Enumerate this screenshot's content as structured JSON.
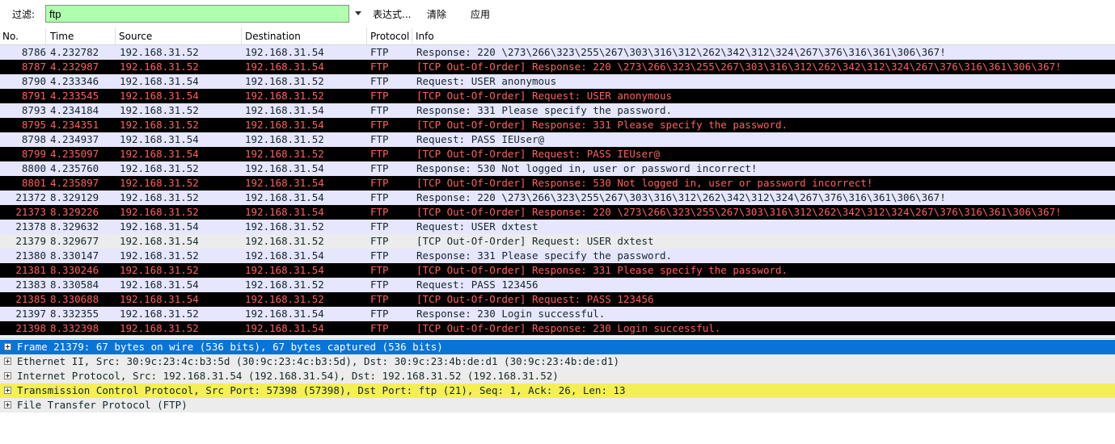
{
  "filter_bar": {
    "label": "过滤:",
    "value": "ftp",
    "expression_button": "表达式...",
    "clear_button": "清除",
    "apply_button": "应用"
  },
  "columns": {
    "no": "No.",
    "time": "Time",
    "source": "Source",
    "destination": "Destination",
    "protocol": "Protocol",
    "info": "Info"
  },
  "packets": [
    {
      "no": "8786",
      "time": "4.232782",
      "src": "192.168.31.52",
      "dst": "192.168.31.54",
      "proto": "FTP",
      "info": "Response: 220 \\273\\266\\323\\255\\267\\303\\316\\312\\262\\342\\312\\324\\267\\376\\316\\361\\306\\367!",
      "style": "ftp"
    },
    {
      "no": "8787",
      "time": "4.232987",
      "src": "192.168.31.52",
      "dst": "192.168.31.54",
      "proto": "FTP",
      "info": "[TCP Out-Of-Order] Response: 220 \\273\\266\\323\\255\\267\\303\\316\\312\\262\\342\\312\\324\\267\\376\\316\\361\\306\\367!",
      "style": "bad"
    },
    {
      "no": "8790",
      "time": "4.233346",
      "src": "192.168.31.54",
      "dst": "192.168.31.52",
      "proto": "FTP",
      "info": "Request: USER anonymous",
      "style": "ftp"
    },
    {
      "no": "8791",
      "time": "4.233545",
      "src": "192.168.31.54",
      "dst": "192.168.31.52",
      "proto": "FTP",
      "info": "[TCP Out-Of-Order] Request: USER anonymous",
      "style": "bad"
    },
    {
      "no": "8793",
      "time": "4.234184",
      "src": "192.168.31.52",
      "dst": "192.168.31.54",
      "proto": "FTP",
      "info": "Response: 331 Please specify the password.",
      "style": "ftp"
    },
    {
      "no": "8795",
      "time": "4.234351",
      "src": "192.168.31.52",
      "dst": "192.168.31.54",
      "proto": "FTP",
      "info": "[TCP Out-Of-Order] Response: 331 Please specify the password.",
      "style": "bad"
    },
    {
      "no": "8798",
      "time": "4.234937",
      "src": "192.168.31.54",
      "dst": "192.168.31.52",
      "proto": "FTP",
      "info": "Request: PASS IEUser@",
      "style": "ftp"
    },
    {
      "no": "8799",
      "time": "4.235097",
      "src": "192.168.31.54",
      "dst": "192.168.31.52",
      "proto": "FTP",
      "info": "[TCP Out-Of-Order] Request: PASS IEUser@",
      "style": "bad"
    },
    {
      "no": "8800",
      "time": "4.235760",
      "src": "192.168.31.52",
      "dst": "192.168.31.54",
      "proto": "FTP",
      "info": "Response: 530 Not logged in, user or password incorrect!",
      "style": "ftp"
    },
    {
      "no": "8801",
      "time": "4.235897",
      "src": "192.168.31.52",
      "dst": "192.168.31.54",
      "proto": "FTP",
      "info": "[TCP Out-Of-Order] Response: 530 Not logged in, user or password incorrect!",
      "style": "bad"
    },
    {
      "no": "21372",
      "time": "8.329129",
      "src": "192.168.31.52",
      "dst": "192.168.31.54",
      "proto": "FTP",
      "info": "Response: 220 \\273\\266\\323\\255\\267\\303\\316\\312\\262\\342\\312\\324\\267\\376\\316\\361\\306\\367!",
      "style": "ftp"
    },
    {
      "no": "21373",
      "time": "8.329226",
      "src": "192.168.31.52",
      "dst": "192.168.31.54",
      "proto": "FTP",
      "info": "[TCP Out-Of-Order] Response: 220 \\273\\266\\323\\255\\267\\303\\316\\312\\262\\342\\312\\324\\267\\376\\316\\361\\306\\367!",
      "style": "bad"
    },
    {
      "no": "21378",
      "time": "8.329632",
      "src": "192.168.31.54",
      "dst": "192.168.31.52",
      "proto": "FTP",
      "info": "Request: USER dxtest",
      "style": "ftp"
    },
    {
      "no": "21379",
      "time": "8.329677",
      "src": "192.168.31.54",
      "dst": "192.168.31.52",
      "proto": "FTP",
      "info": "[TCP Out-Of-Order] Request: USER dxtest",
      "style": "sel"
    },
    {
      "no": "21380",
      "time": "8.330147",
      "src": "192.168.31.52",
      "dst": "192.168.31.54",
      "proto": "FTP",
      "info": "Response: 331 Please specify the password.",
      "style": "ftp"
    },
    {
      "no": "21381",
      "time": "8.330246",
      "src": "192.168.31.52",
      "dst": "192.168.31.54",
      "proto": "FTP",
      "info": "[TCP Out-Of-Order] Response: 331 Please specify the password.",
      "style": "bad"
    },
    {
      "no": "21383",
      "time": "8.330584",
      "src": "192.168.31.54",
      "dst": "192.168.31.52",
      "proto": "FTP",
      "info": "Request: PASS 123456",
      "style": "ftp"
    },
    {
      "no": "21385",
      "time": "8.330688",
      "src": "192.168.31.54",
      "dst": "192.168.31.52",
      "proto": "FTP",
      "info": "[TCP Out-Of-Order] Request: PASS 123456",
      "style": "bad"
    },
    {
      "no": "21397",
      "time": "8.332355",
      "src": "192.168.31.52",
      "dst": "192.168.31.54",
      "proto": "FTP",
      "info": "Response: 230 Login successful.",
      "style": "ftp"
    },
    {
      "no": "21398",
      "time": "8.332398",
      "src": "192.168.31.52",
      "dst": "192.168.31.54",
      "proto": "FTP",
      "info": "[TCP Out-Of-Order] Response: 230 Login successful.",
      "style": "bad"
    }
  ],
  "details": [
    {
      "text": "Frame 21379: 67 bytes on wire (536 bits), 67 bytes captured (536 bits)",
      "style": "selected"
    },
    {
      "text": "Ethernet II, Src: 30:9c:23:4c:b3:5d (30:9c:23:4c:b3:5d), Dst: 30:9c:23:4b:de:d1 (30:9c:23:4b:de:d1)",
      "style": "gray"
    },
    {
      "text": "Internet Protocol, Src: 192.168.31.54 (192.168.31.54), Dst: 192.168.31.52 (192.168.31.52)",
      "style": "gray"
    },
    {
      "text": "Transmission Control Protocol, Src Port: 57398 (57398), Dst Port: ftp (21), Seq: 1, Ack: 26, Len: 13",
      "style": "yellow"
    },
    {
      "text": "File Transfer Protocol (FTP)",
      "style": "gray"
    }
  ]
}
